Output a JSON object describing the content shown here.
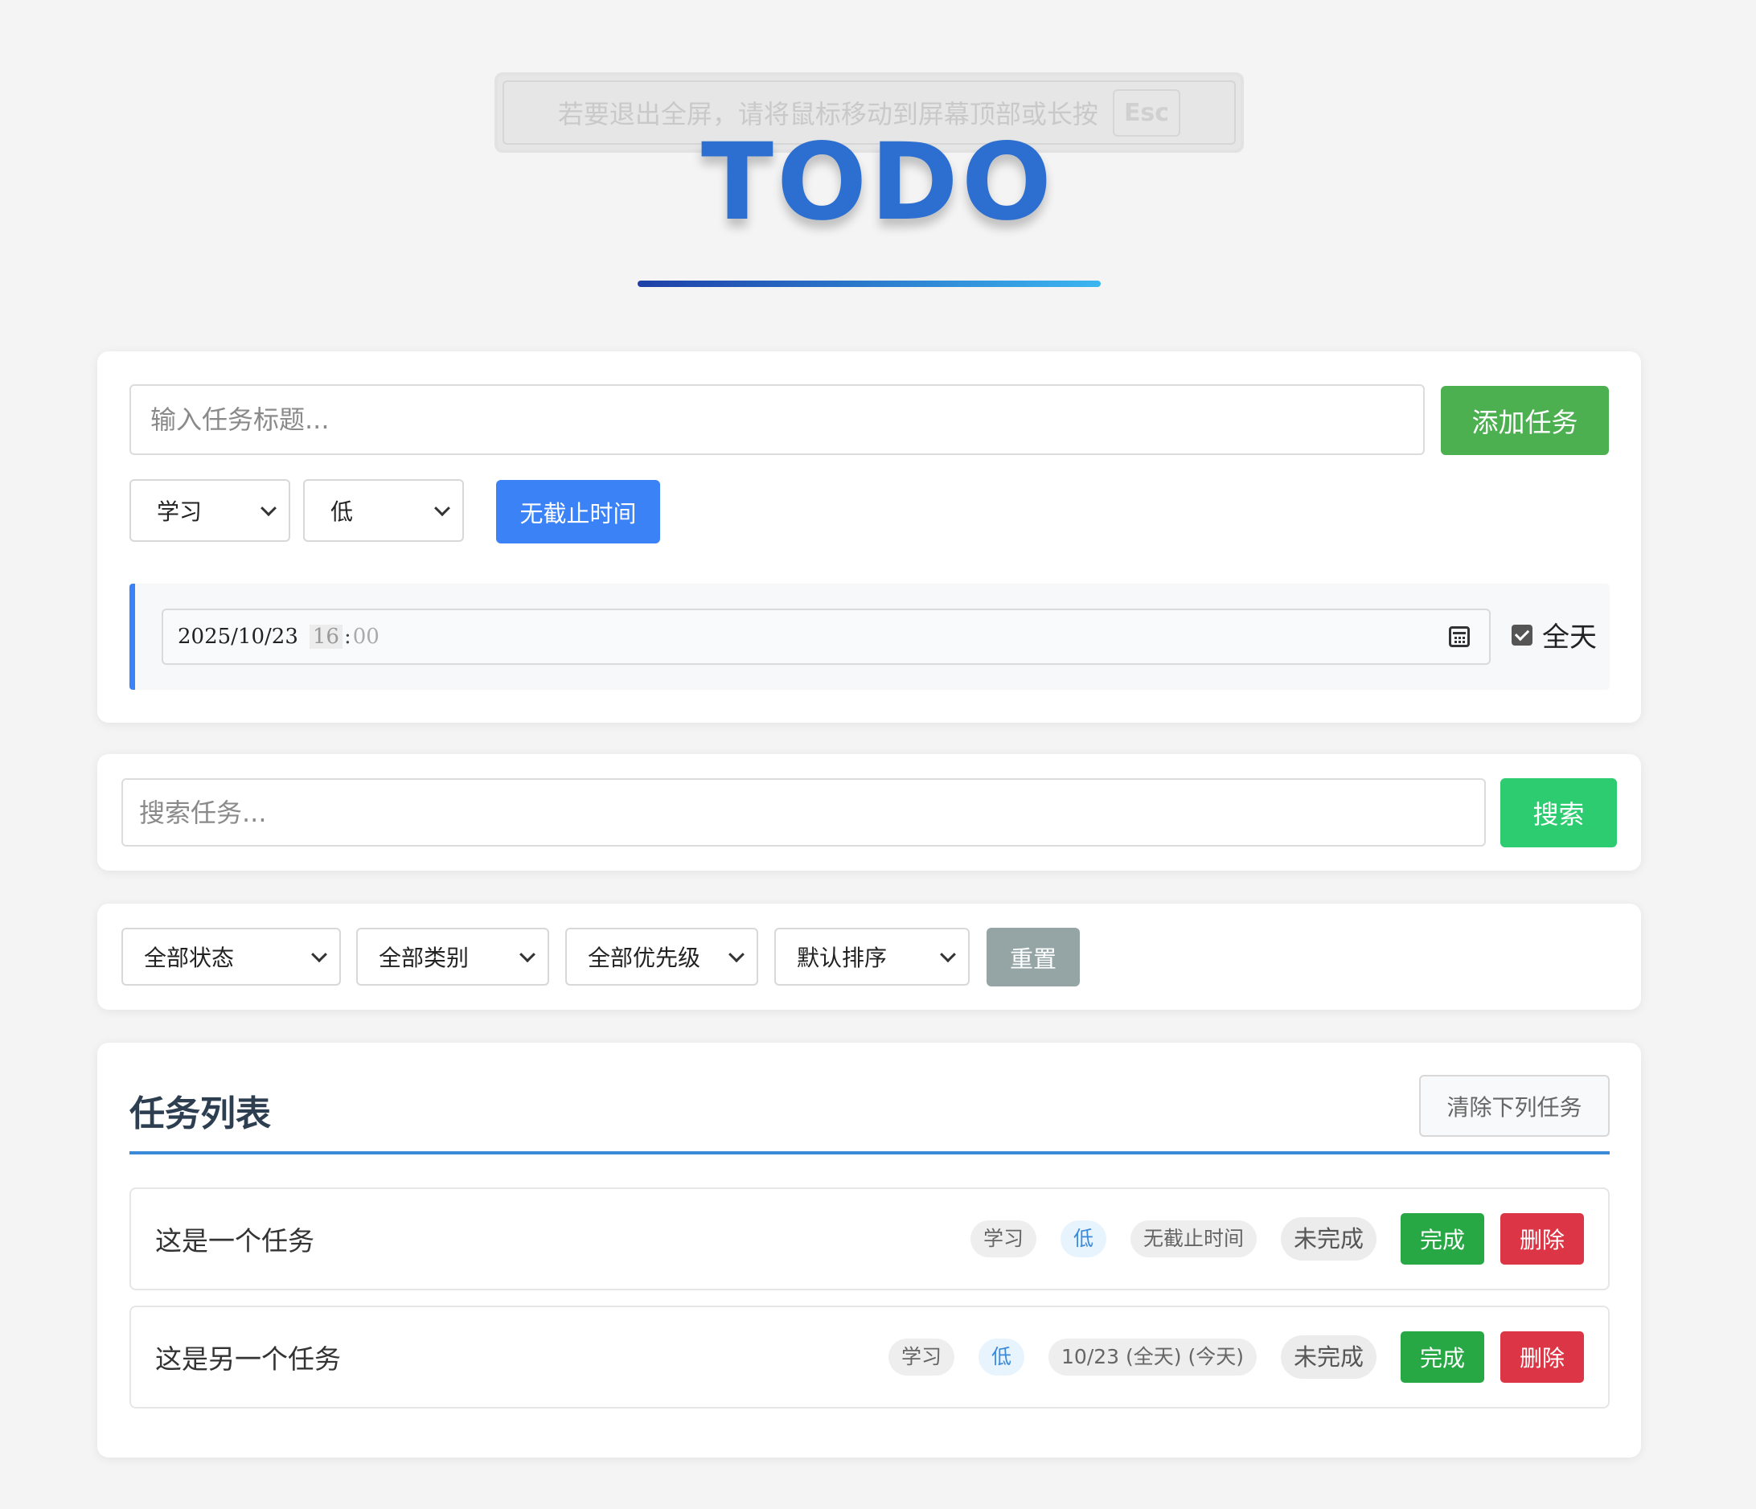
{
  "fullscreen_notice": {
    "text": "若要退出全屏，请将鼠标移动到屏幕顶部或长按",
    "key": "Esc"
  },
  "header": {
    "title": "TODO"
  },
  "add_form": {
    "title_placeholder": "输入任务标题...",
    "add_button": "添加任务",
    "category": "学习",
    "priority": "低",
    "deadline_button": "无截止时间",
    "date_value": "2025/10/23",
    "time_hour": "16",
    "time_minute": "00",
    "allday_label": "全天",
    "allday_checked": true
  },
  "search": {
    "placeholder": "搜索任务...",
    "button": "搜索"
  },
  "filters": {
    "status": "全部状态",
    "category": "全部类别",
    "priority": "全部优先级",
    "sort": "默认排序",
    "reset_button": "重置"
  },
  "task_list": {
    "title": "任务列表",
    "clear_button": "清除下列任务",
    "tasks": [
      {
        "title": "这是一个任务",
        "category": "学习",
        "priority": "低",
        "deadline": "无截止时间",
        "status": "未完成",
        "done_button": "完成",
        "delete_button": "删除"
      },
      {
        "title": "这是另一个任务",
        "category": "学习",
        "priority": "低",
        "deadline": "10/23 (全天) (今天)",
        "status": "未完成",
        "done_button": "完成",
        "delete_button": "删除"
      }
    ]
  },
  "colors": {
    "add_button": "#4caf50",
    "deadline_button": "#3b82f6",
    "search_button": "#2ecc71",
    "reset_button": "#95a5a6",
    "done_button": "#28a745",
    "delete_button": "#dc3545",
    "title": "#2c6fd0"
  }
}
